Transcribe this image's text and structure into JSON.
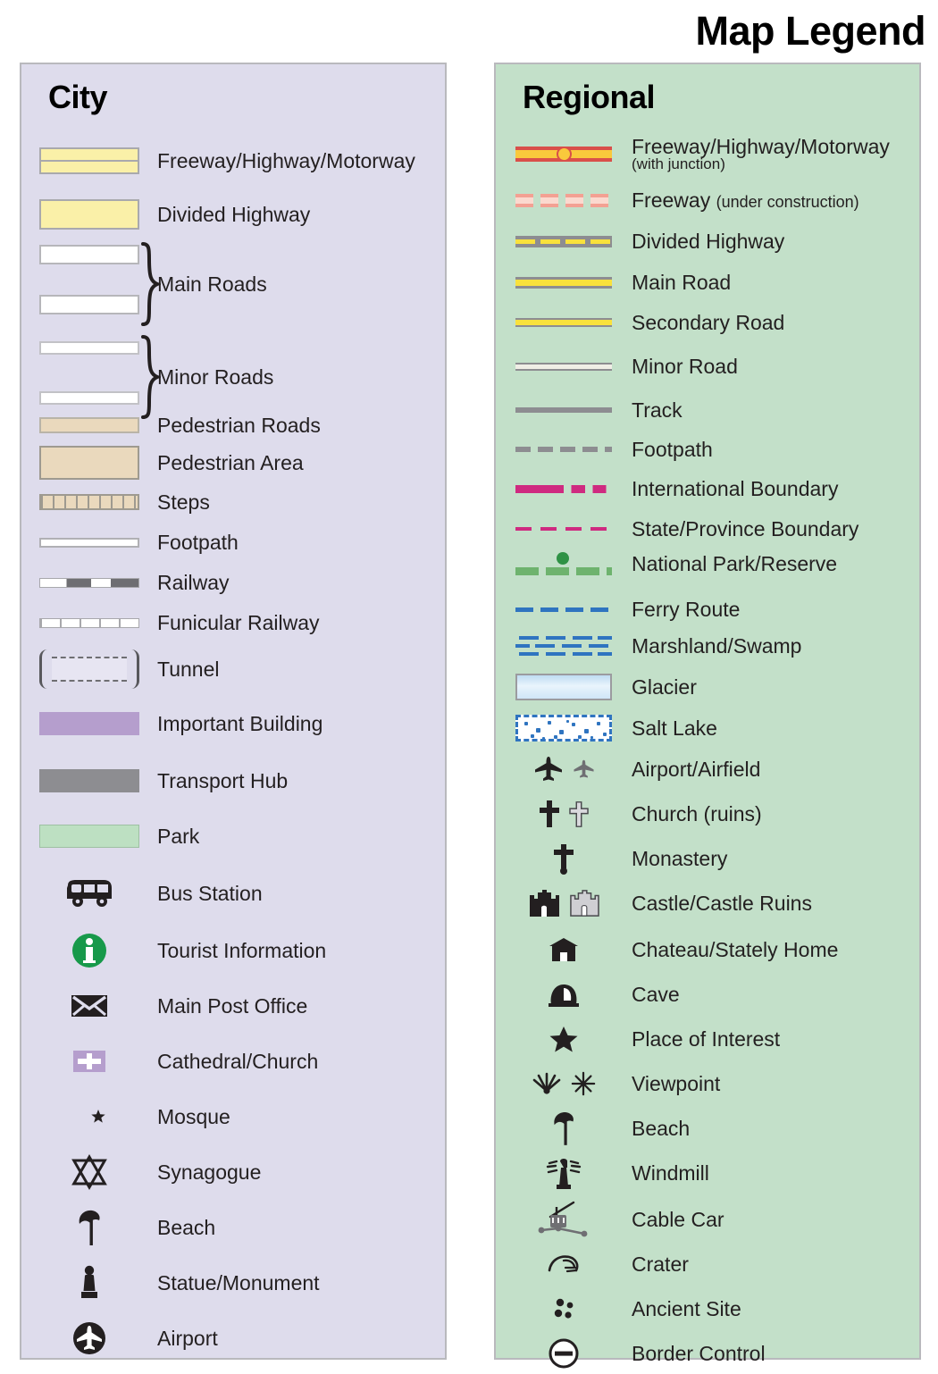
{
  "title": "Map Legend",
  "city": {
    "heading": "City",
    "background_color": "#dedcec",
    "items": [
      {
        "label": "Freeway/Highway/Motorway",
        "symbol": "freeway-divided-swatch"
      },
      {
        "label": "Divided Highway",
        "symbol": "divided-highway-swatch"
      },
      {
        "label": "Main Roads",
        "symbol": "main-roads-swatch-pair"
      },
      {
        "label": "Minor Roads",
        "symbol": "minor-roads-swatch-pair"
      },
      {
        "label": "Pedestrian Roads",
        "symbol": "pedestrian-road-swatch"
      },
      {
        "label": "Pedestrian Area",
        "symbol": "pedestrian-area-swatch"
      },
      {
        "label": "Steps",
        "symbol": "steps-swatch"
      },
      {
        "label": "Footpath",
        "symbol": "footpath-swatch"
      },
      {
        "label": "Railway",
        "symbol": "railway-swatch"
      },
      {
        "label": "Funicular Railway",
        "symbol": "funicular-railway-swatch"
      },
      {
        "label": "Tunnel",
        "symbol": "tunnel-swatch"
      },
      {
        "label": "Important Building",
        "symbol": "important-building-swatch"
      },
      {
        "label": "Transport Hub",
        "symbol": "transport-hub-swatch"
      },
      {
        "label": "Park",
        "symbol": "park-swatch"
      },
      {
        "label": "Bus Station",
        "symbol": "bus-icon"
      },
      {
        "label": "Tourist Information",
        "symbol": "information-icon"
      },
      {
        "label": "Main Post Office",
        "symbol": "envelope-icon"
      },
      {
        "label": "Cathedral/Church",
        "symbol": "church-cross-icon"
      },
      {
        "label": "Mosque",
        "symbol": "crescent-star-icon"
      },
      {
        "label": "Synagogue",
        "symbol": "star-of-david-icon"
      },
      {
        "label": "Beach",
        "symbol": "beach-umbrella-icon"
      },
      {
        "label": "Statue/Monument",
        "symbol": "statue-icon"
      },
      {
        "label": "Airport",
        "symbol": "airport-circle-icon"
      }
    ]
  },
  "regional": {
    "heading": "Regional",
    "background_color": "#c3e0c9",
    "items": [
      {
        "label": "Freeway/Highway/Motorway",
        "sublabel": "(with junction)",
        "symbol": "freeway-junction-line"
      },
      {
        "label": "Freeway",
        "inline_note": "(under construction)",
        "symbol": "freeway-construction-line"
      },
      {
        "label": "Divided Highway",
        "symbol": "divided-highway-line"
      },
      {
        "label": "Main Road",
        "symbol": "main-road-line"
      },
      {
        "label": "Secondary Road",
        "symbol": "secondary-road-line"
      },
      {
        "label": "Minor Road",
        "symbol": "minor-road-line"
      },
      {
        "label": "Track",
        "symbol": "track-line"
      },
      {
        "label": "Footpath",
        "symbol": "footpath-dashed-line"
      },
      {
        "label": "International Boundary",
        "symbol": "international-boundary-line"
      },
      {
        "label": "State/Province Boundary",
        "symbol": "state-boundary-line"
      },
      {
        "label": "National Park/Reserve",
        "symbol": "national-park-line"
      },
      {
        "label": "Ferry Route",
        "symbol": "ferry-route-line"
      },
      {
        "label": "Marshland/Swamp",
        "symbol": "marshland-pattern"
      },
      {
        "label": "Glacier",
        "symbol": "glacier-swatch"
      },
      {
        "label": "Salt Lake",
        "symbol": "salt-lake-swatch"
      },
      {
        "label": "Airport/Airfield",
        "symbol": "airplane-pair-icon"
      },
      {
        "label": "Church (ruins)",
        "symbol": "church-ruins-cross-icon"
      },
      {
        "label": "Monastery",
        "symbol": "monastery-cross-icon"
      },
      {
        "label": "Castle/Castle Ruins",
        "symbol": "castle-pair-icon"
      },
      {
        "label": "Chateau/Stately Home",
        "symbol": "chateau-icon"
      },
      {
        "label": "Cave",
        "symbol": "cave-icon"
      },
      {
        "label": "Place of Interest",
        "symbol": "star-icon"
      },
      {
        "label": "Viewpoint",
        "symbol": "viewpoint-pair-icon"
      },
      {
        "label": "Beach",
        "symbol": "beach-umbrella-icon"
      },
      {
        "label": "Windmill",
        "symbol": "windmill-icon"
      },
      {
        "label": "Cable Car",
        "symbol": "cable-car-icon"
      },
      {
        "label": "Crater",
        "symbol": "crater-icon"
      },
      {
        "label": "Ancient Site",
        "symbol": "ancient-site-icon"
      },
      {
        "label": "Border Control",
        "symbol": "border-control-icon"
      }
    ]
  },
  "colors": {
    "city_panel": "#dedcec",
    "regional_panel": "#c3e0c9",
    "highway_yellow": "#faf0a8",
    "freeway_red": "#d94f4a",
    "road_yellow": "#f9e13c",
    "boundary_magenta": "#cf2a80",
    "park_green": "#bde0c2",
    "important_building_purple": "#b59ecd",
    "transport_hub_gray": "#8d8d91",
    "pedestrian_tan": "#ead9bd",
    "water_blue": "#2f74c0",
    "info_green": "#17994a"
  }
}
